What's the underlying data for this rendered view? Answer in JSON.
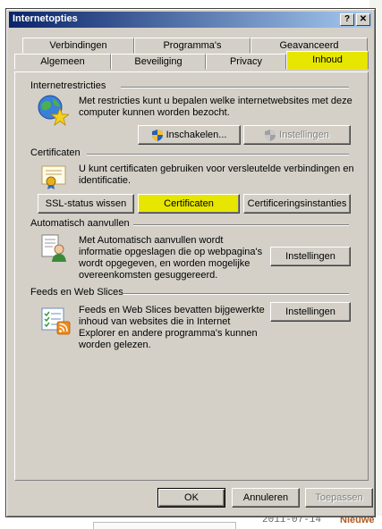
{
  "window": {
    "title": "Internetopties",
    "help_glyph": "?",
    "close_glyph": "✕"
  },
  "tabs": {
    "row1": [
      "Verbindingen",
      "Programma's",
      "Geavanceerd"
    ],
    "row2": [
      "Algemeen",
      "Beveiliging",
      "Privacy",
      "Inhoud"
    ],
    "active": "Inhoud"
  },
  "sections": {
    "internet": {
      "title": "Internetrestricties",
      "description": "Met restricties kunt u bepalen welke internetwebsites met deze computer kunnen worden bezocht.",
      "buttons": {
        "enable": "Inschakelen...",
        "settings": "Instellingen"
      },
      "icon": "globe-star-icon"
    },
    "certificates": {
      "title": "Certificaten",
      "description": "U kunt certificaten gebruiken voor versleutelde verbindingen en identificatie.",
      "buttons": {
        "ssl": "SSL-status wissen",
        "certs": "Certificaten",
        "authorities": "Certificeringsinstanties"
      },
      "icon": "certificate-icon"
    },
    "autocomplete": {
      "title": "Automatisch aanvullen",
      "description": "Met Automatisch aanvullen wordt informatie opgeslagen die op webpagina's wordt opgegeven, en worden mogelijke overeenkomsten gesuggereerd.",
      "button": "Instellingen",
      "icon": "autocomplete-icon"
    },
    "feeds": {
      "title": "Feeds en Web Slices",
      "description": "Feeds en Web Slices bevatten bijgewerkte inhoud van websites die in Internet Explorer en andere programma's kunnen worden gelezen.",
      "button": "Instellingen",
      "icon": "feeds-icon"
    }
  },
  "footer": {
    "ok": "OK",
    "cancel": "Annuleren",
    "apply": "Toepassen"
  },
  "background": {
    "date": "2011-07-14",
    "link": "Nieuwe"
  },
  "colors": {
    "highlight": "#e6e600",
    "title_start": "#0a246a",
    "face": "#d4d0c8"
  }
}
